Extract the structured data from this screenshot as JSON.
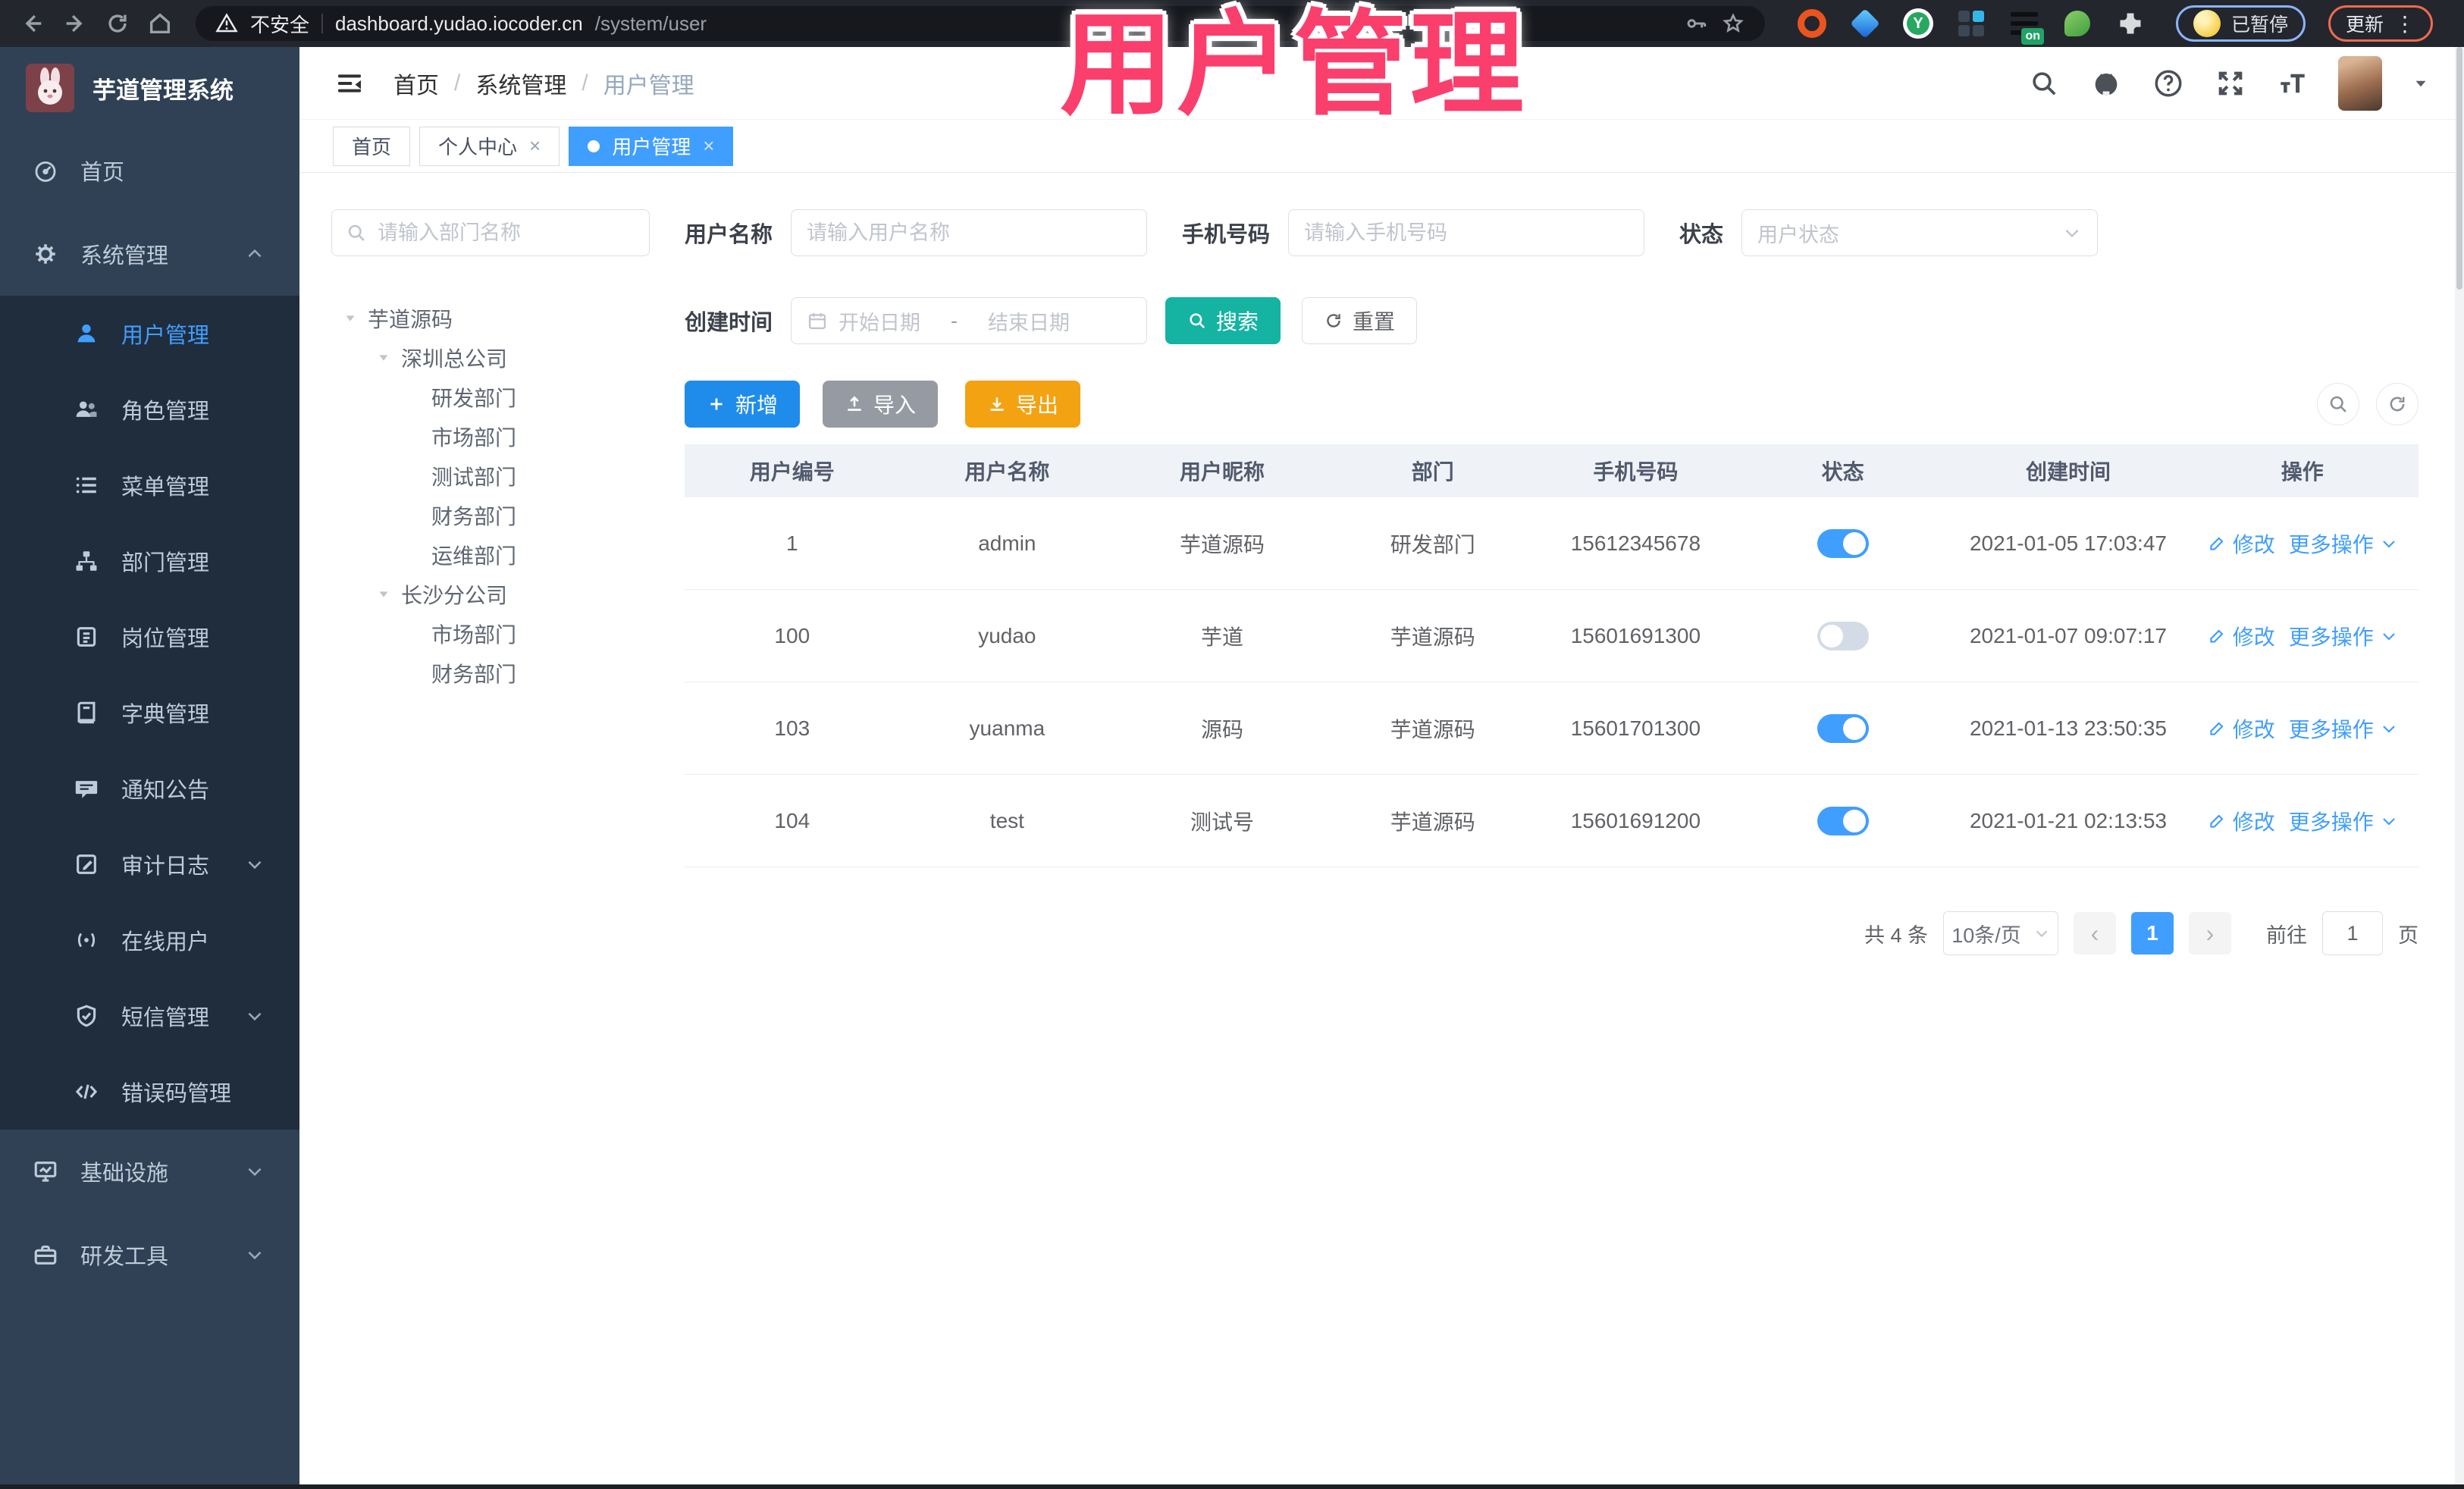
{
  "browser": {
    "security_label": "不安全",
    "url_host": "dashboard.yudao.iocoder.cn",
    "url_path": "/system/user",
    "profile_status": "已暂停",
    "update_label": "更新",
    "menu_dots": "⋮"
  },
  "overlay_title": "用户管理",
  "app": {
    "title": "芋道管理系统",
    "breadcrumb": [
      "首页",
      "系统管理",
      "用户管理"
    ],
    "breadcrumb_separator": "/",
    "tabs": [
      {
        "label": "首页"
      },
      {
        "label": "个人中心"
      },
      {
        "label": "用户管理"
      }
    ],
    "tab_close": "×"
  },
  "sidebar": {
    "items": [
      {
        "label": "首页"
      },
      {
        "label": "系统管理"
      },
      {
        "label": "用户管理"
      },
      {
        "label": "角色管理"
      },
      {
        "label": "菜单管理"
      },
      {
        "label": "部门管理"
      },
      {
        "label": "岗位管理"
      },
      {
        "label": "字典管理"
      },
      {
        "label": "通知公告"
      },
      {
        "label": "审计日志"
      },
      {
        "label": "在线用户"
      },
      {
        "label": "短信管理"
      },
      {
        "label": "错误码管理"
      },
      {
        "label": "基础设施"
      },
      {
        "label": "研发工具"
      }
    ]
  },
  "tree": {
    "search_placeholder": "请输入部门名称",
    "nodes": [
      "芋道源码",
      "深圳总公司",
      "研发部门",
      "市场部门",
      "测试部门",
      "财务部门",
      "运维部门",
      "长沙分公司",
      "市场部门",
      "财务部门"
    ]
  },
  "filters": {
    "username_label": "用户名称",
    "username_placeholder": "请输入用户名称",
    "mobile_label": "手机号码",
    "mobile_placeholder": "请输入手机号码",
    "status_label": "状态",
    "status_placeholder": "用户状态",
    "created_label": "创建时间",
    "date_start_placeholder": "开始日期",
    "date_separator": "-",
    "date_end_placeholder": "结束日期",
    "search_label": "搜索",
    "reset_label": "重置"
  },
  "toolbar": {
    "add_label": "新增",
    "import_label": "导入",
    "export_label": "导出"
  },
  "table": {
    "columns": [
      "用户编号",
      "用户名称",
      "用户昵称",
      "部门",
      "手机号码",
      "状态",
      "创建时间",
      "操作"
    ],
    "edit_label": "修改",
    "more_label": "更多操作",
    "rows": [
      {
        "id": "1",
        "username": "admin",
        "nickname": "芋道源码",
        "dept": "研发部门",
        "mobile": "15612345678",
        "status": "on",
        "created": "2021-01-05 17:03:47"
      },
      {
        "id": "100",
        "username": "yudao",
        "nickname": "芋道",
        "dept": "芋道源码",
        "mobile": "15601691300",
        "status": "off",
        "created": "2021-01-07 09:07:17"
      },
      {
        "id": "103",
        "username": "yuanma",
        "nickname": "源码",
        "dept": "芋道源码",
        "mobile": "15601701300",
        "status": "on",
        "created": "2021-01-13 23:50:35"
      },
      {
        "id": "104",
        "username": "test",
        "nickname": "测试号",
        "dept": "芋道源码",
        "mobile": "15601691200",
        "status": "on",
        "created": "2021-01-21 02:13:53"
      }
    ]
  },
  "pagination": {
    "total": "共 4 条",
    "page_size": "10条/页",
    "prev": "‹",
    "next": "›",
    "page": "1",
    "goto_label": "前往",
    "goto_value": "1",
    "unit_label": "页"
  },
  "colors": {
    "accent": "#409eff",
    "search_teal": "#14b3a2",
    "export_orange": "#f3a212",
    "sidebar_bg": "#304156",
    "submenu_bg": "#1f2d3d",
    "overlay_pink": "#fa3f6d"
  }
}
